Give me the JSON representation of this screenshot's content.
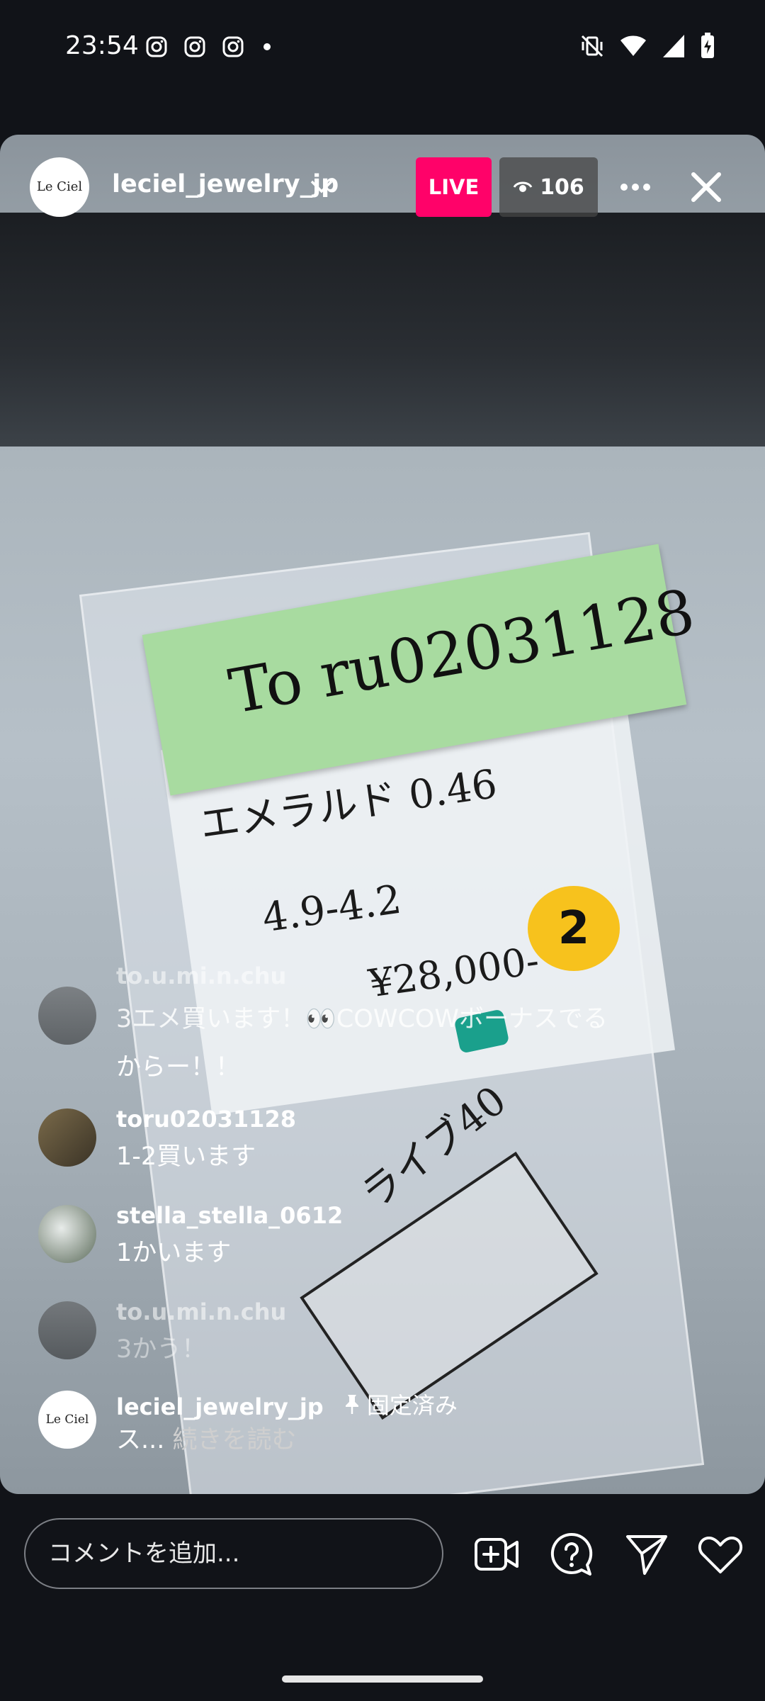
{
  "status_bar": {
    "time": "23:54",
    "left_icons": [
      "instagram-icon",
      "instagram-icon",
      "instagram-icon",
      "dot-icon"
    ],
    "right_icons": [
      "mute-vibrate-icon",
      "wifi-icon",
      "signal-icon",
      "battery-charging-icon"
    ]
  },
  "header": {
    "avatar_text": "Le Ciel",
    "username": "leciel_jewelry_jp",
    "live_label": "LIVE",
    "viewer_count": "106"
  },
  "video": {
    "sticky_note": "To ru02031128",
    "line1": "エメラルド 0.46",
    "line2": "4.9-4.2",
    "line3": "¥28,000-",
    "line4": "ライブ40",
    "yellow_number": "2"
  },
  "comments": [
    {
      "user": "to.u.mi.n.chu",
      "text": "3エメ買います！👀COWCOWボーナスでる",
      "text2": "からー！！"
    },
    {
      "user": "toru02031128",
      "text": "1-2買います"
    },
    {
      "user": "stella_stella_0612",
      "text": "1かいます"
    },
    {
      "user": "to.u.mi.n.chu",
      "text": "3かう！"
    },
    {
      "user": "leciel_jewelry_jp",
      "pinned_label": "固定済み",
      "text_start": "ス...",
      "read_more": "続きを読む",
      "avatar_text": "Le Ciel"
    }
  ],
  "bottom_bar": {
    "comment_placeholder": "コメントを追加...",
    "icons": [
      "add-video-icon",
      "question-icon",
      "send-icon",
      "heart-icon"
    ]
  },
  "colors": {
    "live": "#ff0269",
    "background": "#111318"
  }
}
